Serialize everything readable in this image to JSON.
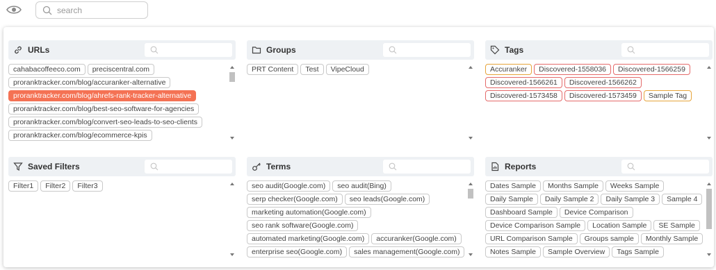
{
  "search": {
    "placeholder": "search"
  },
  "panels": {
    "urls": {
      "title": "URLs",
      "items": [
        "cahabacoffeeco.com",
        "preciscentral.com",
        "proranktracker.com/blog/accuranker-alternative",
        "proranktracker.com/blog/ahrefs-rank-tracker-alternative",
        "proranktracker.com/blog/best-seo-software-for-agencies",
        "proranktracker.com/blog/convert-seo-leads-to-seo-clients",
        "proranktracker.com/blog/ecommerce-kpis"
      ]
    },
    "groups": {
      "title": "Groups",
      "items": [
        "PRT Content",
        "Test",
        "VipeCloud"
      ]
    },
    "tags": {
      "title": "Tags",
      "items": [
        "Accuranker",
        "Discovered-1558036",
        "Discovered-1566259",
        "Discovered-1566261",
        "Discovered-1566262",
        "Discovered-1573458",
        "Discovered-1573459",
        "Sample Tag"
      ]
    },
    "saved_filters": {
      "title": "Saved Filters",
      "items": [
        "Filter1",
        "Filter2",
        "Filter3"
      ]
    },
    "terms": {
      "title": "Terms",
      "items": [
        "seo audit(Google.com)",
        "seo audit(Bing)",
        "serp checker(Google.com)",
        "seo leads(Google.com)",
        "marketing automation(Google.com)",
        "seo rank software(Google.com)",
        "automated marketing(Google.com)",
        "accuranker(Google.com)",
        "enterprise seo(Google.com)",
        "sales management(Google.com)"
      ]
    },
    "reports": {
      "title": "Reports",
      "items": [
        "Dates Sample",
        "Months Sample",
        "Weeks Sample",
        "Daily Sample",
        "Daily Sample 2",
        "Daily Sample 3",
        "Sample 4",
        "Dashboard Sample",
        "Device Comparison",
        "Device Comparison Sample",
        "Location Sample",
        "SE Sample",
        "URL Comparison Sample",
        "Groups sample",
        "Monthly Sample",
        "Notes Sample",
        "Sample Overview",
        "Tags Sample"
      ]
    }
  },
  "colors": {
    "active_chip": "#f47254",
    "tag_orange_border": "#e6a43a",
    "tag_red_border": "#e46a6a",
    "header_bg": "#eef1f4"
  }
}
